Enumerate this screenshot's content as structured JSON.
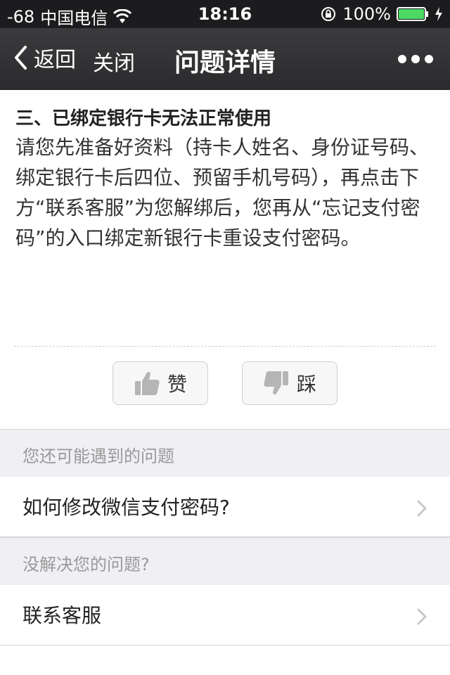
{
  "status_bar": {
    "signal": "-68",
    "carrier": "中国电信",
    "time": "18:16",
    "battery": "100%",
    "battery_level": 1.0,
    "icons": [
      "wifi-icon",
      "rotation-lock-icon",
      "battery-icon",
      "charging-bolt-icon"
    ]
  },
  "navbar": {
    "back_label": "返回",
    "close_label": "关闭",
    "title": "问题详情",
    "more_icon": "more-dots-icon"
  },
  "article": {
    "heading": "三、已绑定银行卡无法正常使用",
    "body": "请您先准备好资料（持卡人姓名、身份证号码、绑定银行卡后四位、预留手机号码），再点击下方“联系客服”为您解绑后，您再从“忘记支付密码”的入口绑定新银行卡重设支付密码。"
  },
  "votes": {
    "like_label": "赞",
    "dislike_label": "踩",
    "like_icon": "thumbs-up-icon",
    "dislike_icon": "thumbs-down-icon"
  },
  "related": {
    "header": "您还可能遇到的问题",
    "items": [
      {
        "label": "如何修改微信支付密码?"
      }
    ]
  },
  "unsolved": {
    "header": "没解决您的问题?",
    "items": [
      {
        "label": "联系客服"
      }
    ]
  },
  "colors": {
    "statusbar_bg": "#1c1c1e",
    "navbar_bg": "#333335",
    "battery_green": "#4cd964",
    "section_bg": "#efeff4"
  }
}
